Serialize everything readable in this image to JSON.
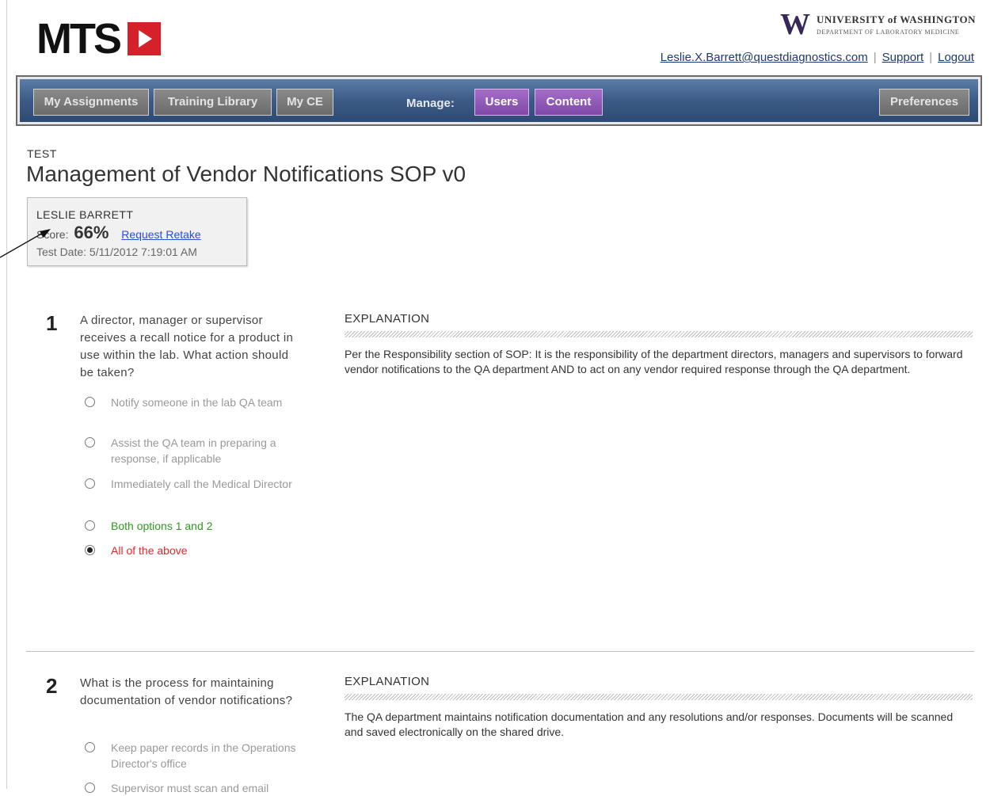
{
  "brand": {
    "logo_text": "MTS"
  },
  "university": {
    "mark": "W",
    "line1": "UNIVERSITY of WASHINGTON",
    "line2": "DEPARTMENT OF LABORATORY MEDICINE"
  },
  "top_links": {
    "email": "Leslie.X.Barrett@questdiagnostics.com",
    "support": "Support",
    "logout": "Logout",
    "separator": "|"
  },
  "nav": {
    "my_assignments": "My Assignments",
    "training_library": "Training Library",
    "my_ce": "My CE",
    "manage_label": "Manage:",
    "users": "Users",
    "content": "Content",
    "preferences": "Preferences"
  },
  "page": {
    "kicker": "TEST",
    "title": "Management of Vendor Notifications SOP v0"
  },
  "score_box": {
    "name": "LESLIE BARRETT",
    "score_label": "Score:",
    "score_value": "66%",
    "retake_link": "Request Retake",
    "date_label": "Test Date:",
    "date_value": "5/11/2012 7:19:01 AM"
  },
  "questions": [
    {
      "number": "1",
      "text": "A director, manager or supervisor receives a recall notice for a product in use within the lab. What action should be taken?",
      "options": [
        {
          "label": "Notify someone in the lab QA team",
          "state": "normal"
        },
        {
          "label": "Assist the QA team in preparing a response, if applicable",
          "state": "normal"
        },
        {
          "label": "Immediately call the Medical Director",
          "state": "normal"
        },
        {
          "label": "Both options 1 and 2",
          "state": "correct"
        },
        {
          "label": "All of the above",
          "state": "selected-wrong"
        }
      ],
      "explanation_heading": "EXPLANATION",
      "explanation": "Per the Responsibility section of SOP: It is the responsibility of the department directors, managers and supervisors to forward vendor notifications to the QA department AND to act on any vendor required response through the QA department."
    },
    {
      "number": "2",
      "text": "What is the process for maintaining documentation of vendor notifications?",
      "options": [
        {
          "label": "Keep paper records in the Operations Director's office",
          "state": "normal"
        },
        {
          "label": "Supervisor must scan and email",
          "state": "normal"
        }
      ],
      "explanation_heading": "EXPLANATION",
      "explanation": "The QA department maintains notification documentation and any resolutions and/or responses. Documents will be scanned and saved electronically on the shared drive."
    }
  ],
  "colors": {
    "nav_blue": "#3b5b86",
    "manage_purple": "#8b55b3",
    "correct_green": "#2e9a20",
    "wrong_red": "#e8242a",
    "brand_red": "#d6202a",
    "uw_purple": "#39275b"
  },
  "icons": {
    "logo_play": "play-triangle-icon",
    "annotation": "arrow-annotation-icon"
  }
}
